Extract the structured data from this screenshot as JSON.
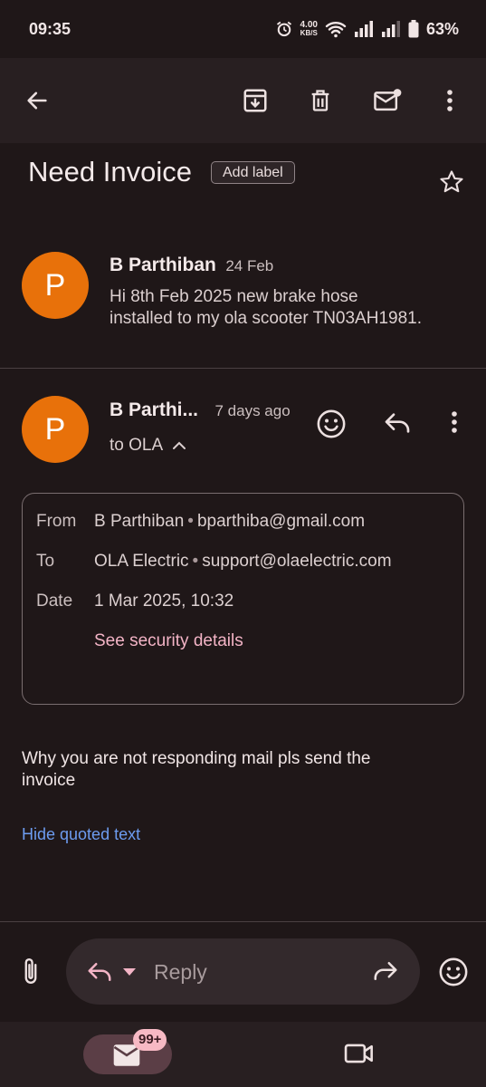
{
  "status_bar": {
    "time": "09:35",
    "net_speed_value": "4.00",
    "net_speed_unit": "KB/S",
    "battery": "63%",
    "icons": [
      "alarm-icon",
      "wifi-icon",
      "signal-icon",
      "signal-icon",
      "battery-icon"
    ]
  },
  "toolbar": {
    "icons": [
      "back-arrow-icon",
      "archive-icon",
      "delete-icon",
      "mark-unread-icon",
      "more-vert-icon"
    ]
  },
  "subject": {
    "title": "Need Invoice",
    "add_label": "Add label"
  },
  "messages": [
    {
      "avatar_letter": "P",
      "sender": "B Parthiban",
      "date": "24 Feb",
      "snippet_line1": "Hi 8th Feb 2025 new brake hose",
      "snippet_line2": "installed to my ola scooter TN03AH1981."
    },
    {
      "avatar_letter": "P",
      "sender": "B Parthi...",
      "date": "7 days ago",
      "to_line": "to OLA",
      "details": {
        "from_label": "From",
        "from_name": "B Parthiban",
        "from_email": "bparthiba@gmail.com",
        "to_label": "To",
        "to_name": "OLA Electric",
        "to_email": "support@olaelectric.com",
        "date_label": "Date",
        "date_value": "1 Mar 2025, 10:32",
        "security_link": "See security details"
      },
      "body_line1": "Why you are not responding mail pls send the",
      "body_line2": "invoice",
      "hide_quoted": "Hide quoted text"
    }
  ],
  "reply_bar": {
    "placeholder": "Reply"
  },
  "bottom_nav": {
    "mail_badge": "99+"
  },
  "colors": {
    "avatar": "#e8710a",
    "link_blue": "#6d9cf0",
    "link_pink": "#f3b4c6",
    "badge": "#f7b9c4"
  }
}
